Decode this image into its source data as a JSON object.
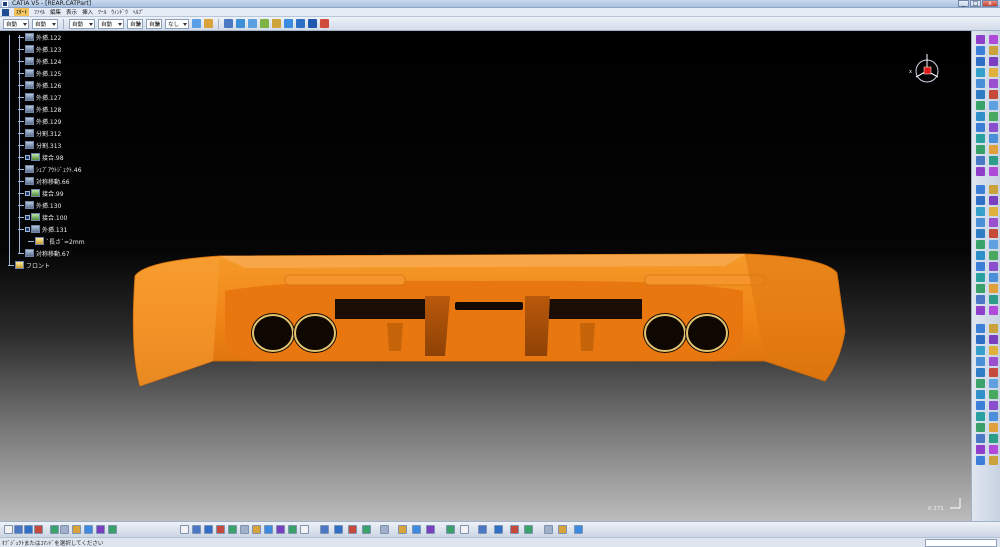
{
  "window": {
    "title": "CATIA V5 - [REAR.CATPart]",
    "minimize_label": "_",
    "maximize_label": "□",
    "close_label": "x"
  },
  "menubar": {
    "items": [
      "ｽﾀｰﾄ",
      "ﾌｧｲﾙ",
      "編集",
      "表示",
      "挿入",
      "ﾂｰﾙ",
      "ｳｨﾝﾄﾞｳ",
      "ﾍﾙﾌﾟ"
    ]
  },
  "toolbar_top": {
    "combos": [
      "自動",
      "自動",
      "自動",
      "自動",
      "自動",
      "自動",
      "なし"
    ]
  },
  "tree": {
    "items": [
      {
        "label": "外挿.122",
        "icon": "extrapolate-icon"
      },
      {
        "label": "外挿.123",
        "icon": "extrapolate-icon"
      },
      {
        "label": "外挿.124",
        "icon": "extrapolate-icon"
      },
      {
        "label": "外挿.125",
        "icon": "extrapolate-icon"
      },
      {
        "label": "外挿.126",
        "icon": "extrapolate-icon"
      },
      {
        "label": "外挿.127",
        "icon": "extrapolate-icon"
      },
      {
        "label": "外挿.128",
        "icon": "extrapolate-icon"
      },
      {
        "label": "外挿.129",
        "icon": "extrapolate-icon"
      },
      {
        "label": "分割.312",
        "icon": "split-icon"
      },
      {
        "label": "分割.313",
        "icon": "split-icon"
      },
      {
        "label": "接合.98",
        "icon": "join-icon"
      },
      {
        "label": "ｼｪﾌﾞｱｳﾄｼﾞｪｸﾄ.46",
        "icon": "shape-object-icon"
      },
      {
        "label": "対称移動.66",
        "icon": "symmetry-icon"
      },
      {
        "label": "接合.99",
        "icon": "join-icon"
      },
      {
        "label": "外挿.130",
        "icon": "extrapolate-icon"
      },
      {
        "label": "接合.100",
        "icon": "join-icon"
      },
      {
        "label": "外挿.131",
        "icon": "extrapolate-icon"
      },
      {
        "label": "`長さ`=2mm",
        "icon": "parameter-icon"
      },
      {
        "label": "対称移動.67",
        "icon": "symmetry-icon"
      },
      {
        "label": "フロント",
        "icon": "plane-icon"
      }
    ]
  },
  "compass": {
    "x_label": "x"
  },
  "viewport": {
    "scale_value": "0.271",
    "part_color": "#f28a17",
    "exhaust_ring_color": "#e3c470"
  },
  "statusbar": {
    "text": "ｵﾌﾞｼﾞｪｸﾄまたはｺﾏﾝﾄﾞを選択してください"
  },
  "colors": {
    "accent": "#f4c55f",
    "viewport_top": "#000000",
    "viewport_bottom": "#bcbcbc"
  }
}
